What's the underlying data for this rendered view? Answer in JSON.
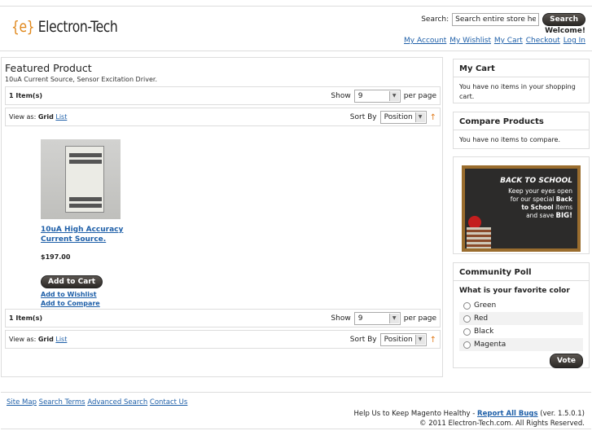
{
  "header": {
    "logo_brace": "{e}",
    "logo_text": "Electron-Tech",
    "search_label": "Search:",
    "search_placeholder": "Search entire store here...",
    "search_button": "Search",
    "welcome": "Welcome!",
    "links": [
      "My Account",
      "My Wishlist",
      "My Cart",
      "Checkout",
      "Log In"
    ]
  },
  "main": {
    "title": "Featured Product",
    "subtitle": "10uA Current Source, Sensor Excitation Driver.",
    "toolbar_top": {
      "items_count": "1 Item(s)",
      "show_label": "Show",
      "per_page_value": "9",
      "per_page_label": "per page"
    },
    "view_top": {
      "view_as": "View as:",
      "grid": "Grid",
      "list": "List",
      "sort_by": "Sort By",
      "sort_value": "Position"
    },
    "product": {
      "name": "10uA High Accuracy Current Source.",
      "price": "$197.00",
      "add_to_cart": "Add to Cart",
      "add_to_wishlist": "Add to Wishlist",
      "add_to_compare": "Add to Compare"
    },
    "toolbar_bottom": {
      "items_count": "1 Item(s)",
      "show_label": "Show",
      "per_page_value": "9",
      "per_page_label": "per page"
    },
    "view_bottom": {
      "view_as": "View as:",
      "grid": "Grid",
      "list": "List",
      "sort_by": "Sort By",
      "sort_value": "Position"
    }
  },
  "sidebar": {
    "cart": {
      "title": "My Cart",
      "content": "You have no items in your shopping cart."
    },
    "compare": {
      "title": "Compare Products",
      "content": "You have no items to compare."
    },
    "promo": {
      "heading": "BACK TO SCHOOL",
      "line1": "Keep your eyes open",
      "line2_pre": "for our special ",
      "line2_bold": "Back",
      "line3": "to School",
      "line3_post": " items",
      "line4_pre": "and save ",
      "line4_bold": "BIG!"
    },
    "poll": {
      "title": "Community Poll",
      "question": "What is your favorite color",
      "options": [
        "Green",
        "Red",
        "Black",
        "Magenta"
      ],
      "vote_button": "Vote"
    }
  },
  "footer": {
    "links": [
      "Site Map",
      "Search Terms",
      "Advanced Search",
      "Contact Us"
    ],
    "help_pre": "Help Us to Keep Magento Healthy - ",
    "help_link": "Report All Bugs",
    "help_post": " (ver. 1.5.0.1)",
    "copyright": "© 2011 Electron-Tech.com. All Rights Reserved."
  },
  "colors": {
    "link": "#1e5fa8",
    "accent_orange": "#e0871a",
    "button_dark": "#2c2926"
  }
}
